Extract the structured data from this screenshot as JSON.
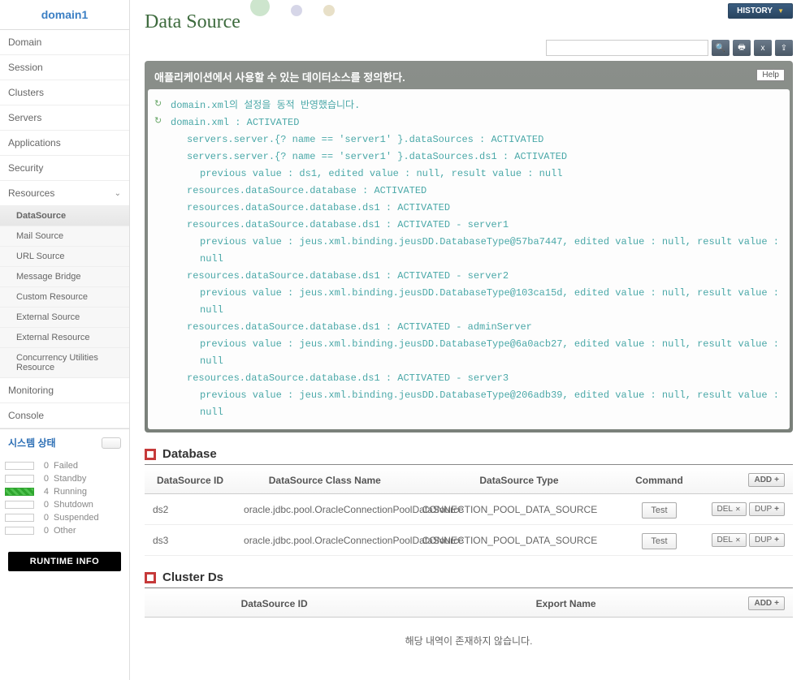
{
  "domain_title": "domain1",
  "nav": [
    "Domain",
    "Session",
    "Clusters",
    "Servers",
    "Applications",
    "Security"
  ],
  "nav_resources": "Resources",
  "subnav": [
    "DataSource",
    "Mail Source",
    "URL Source",
    "Message Bridge",
    "Custom Resource",
    "External Source",
    "External Resource",
    "Concurrency Utilities Resource"
  ],
  "nav_bottom": [
    "Monitoring",
    "Console"
  ],
  "status": {
    "title": "시스템 상태",
    "rows": [
      {
        "n": "0",
        "label": "Failed",
        "cls": ""
      },
      {
        "n": "0",
        "label": "Standby",
        "cls": ""
      },
      {
        "n": "4",
        "label": "Running",
        "cls": "green"
      },
      {
        "n": "0",
        "label": "Shutdown",
        "cls": ""
      },
      {
        "n": "0",
        "label": "Suspended",
        "cls": ""
      },
      {
        "n": "0",
        "label": "Other",
        "cls": ""
      }
    ]
  },
  "runtime_btn": "RUNTIME INFO",
  "history_btn": "HISTORY",
  "page_title": "Data Source",
  "help_btn": "Help",
  "msg_head": "애플리케이션에서 사용할 수 있는 데이터소스를 정의한다.",
  "msg_lines": [
    {
      "reload": true,
      "indent": 0,
      "t": "domain.xml의 설정을 동적 반영했습니다."
    },
    {
      "reload": true,
      "indent": 0,
      "t": "domain.xml : ACTIVATED"
    },
    {
      "reload": false,
      "indent": 1,
      "t": "servers.server.{? name == 'server1' }.dataSources : ACTIVATED"
    },
    {
      "reload": false,
      "indent": 1,
      "t": "servers.server.{? name == 'server1' }.dataSources.ds1 : ACTIVATED"
    },
    {
      "reload": false,
      "indent": 2,
      "t": "previous value : ds1, edited value : null, result value : null"
    },
    {
      "reload": false,
      "indent": 1,
      "t": "resources.dataSource.database : ACTIVATED"
    },
    {
      "reload": false,
      "indent": 1,
      "t": "resources.dataSource.database.ds1 : ACTIVATED"
    },
    {
      "reload": false,
      "indent": 1,
      "t": "resources.dataSource.database.ds1 : ACTIVATED - server1"
    },
    {
      "reload": false,
      "indent": 2,
      "t": "previous value : jeus.xml.binding.jeusDD.DatabaseType@57ba7447, edited value : null, result value : null"
    },
    {
      "reload": false,
      "indent": 1,
      "t": "resources.dataSource.database.ds1 : ACTIVATED - server2"
    },
    {
      "reload": false,
      "indent": 2,
      "t": "previous value : jeus.xml.binding.jeusDD.DatabaseType@103ca15d, edited value : null, result value : null"
    },
    {
      "reload": false,
      "indent": 1,
      "t": "resources.dataSource.database.ds1 : ACTIVATED - adminServer"
    },
    {
      "reload": false,
      "indent": 2,
      "t": "previous value : jeus.xml.binding.jeusDD.DatabaseType@6a0acb27, edited value : null, result value : null"
    },
    {
      "reload": false,
      "indent": 1,
      "t": "resources.dataSource.database.ds1 : ACTIVATED - server3"
    },
    {
      "reload": false,
      "indent": 2,
      "t": "previous value : jeus.xml.binding.jeusDD.DatabaseType@206adb39, edited value : null, result value : null"
    }
  ],
  "sec_database": "Database",
  "db_cols": {
    "id": "DataSource ID",
    "cls": "DataSource Class Name",
    "type": "DataSource Type",
    "cmd": "Command"
  },
  "db_rows": [
    {
      "id": "ds2",
      "cls": "oracle.jdbc.pool.OracleConnectionPoolDataSource",
      "type": "CONNECTION_POOL_DATA_SOURCE"
    },
    {
      "id": "ds3",
      "cls": "oracle.jdbc.pool.OracleConnectionPoolDataSource",
      "type": "CONNECTION_POOL_DATA_SOURCE"
    }
  ],
  "btn_add": "ADD",
  "btn_del": "DEL",
  "btn_dup": "DUP",
  "btn_test": "Test",
  "sec_cluster": "Cluster Ds",
  "cluster_cols": {
    "id": "DataSource ID",
    "export": "Export Name"
  },
  "cluster_empty": "해당 내역이 존재하지 않습니다."
}
